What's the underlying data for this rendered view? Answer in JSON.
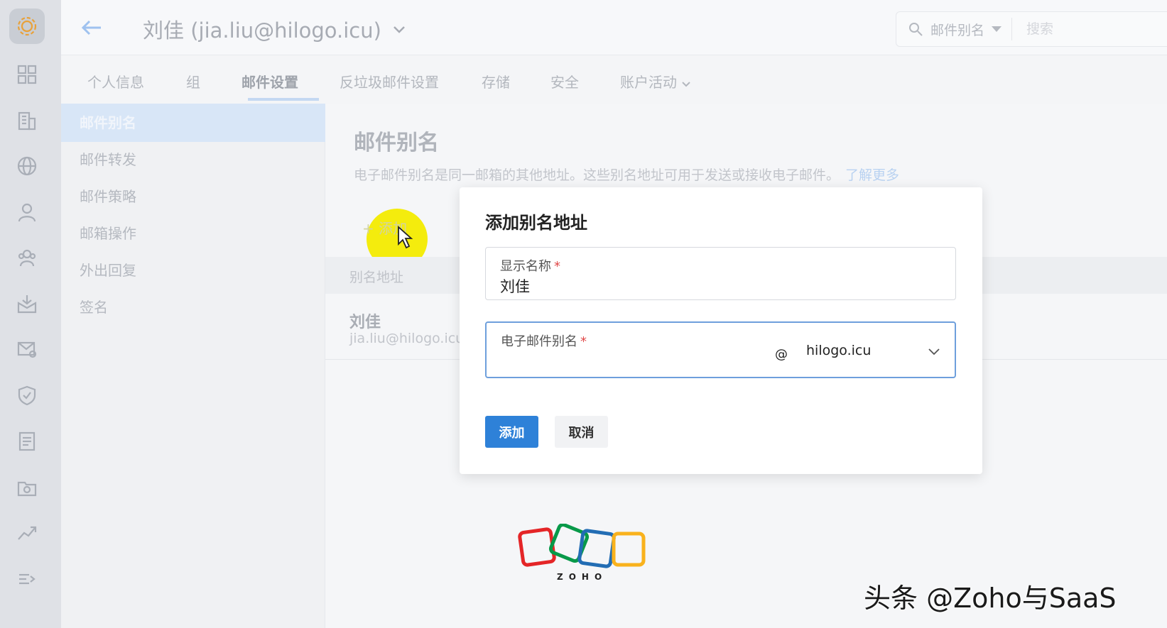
{
  "header": {
    "account": "刘佳 (jia.liu@hilogo.icu)",
    "search_scope": "邮件别名",
    "search_placeholder": "搜索"
  },
  "tabs": [
    {
      "label": "个人信息"
    },
    {
      "label": "组"
    },
    {
      "label": "邮件设置",
      "active": true
    },
    {
      "label": "反垃圾邮件设置"
    },
    {
      "label": "存储"
    },
    {
      "label": "安全"
    },
    {
      "label": "账户活动"
    }
  ],
  "submenu": [
    {
      "label": "邮件别名",
      "active": true
    },
    {
      "label": "邮件转发"
    },
    {
      "label": "邮件策略"
    },
    {
      "label": "邮箱操作"
    },
    {
      "label": "外出回复"
    },
    {
      "label": "签名"
    }
  ],
  "main": {
    "title": "邮件别名",
    "description": "电子邮件别名是同一邮箱的其他地址。这些别名地址可用于发送或接收电子邮件。",
    "learn_more": "了解更多",
    "add_button": "+ 添加",
    "table_header": "别名地址",
    "row": {
      "name": "刘佳",
      "address": "jia.liu@hilogo.icu"
    }
  },
  "dialog": {
    "title": "添加别名地址",
    "display_name_label": "显示名称",
    "display_name_value": "刘佳",
    "alias_label": "电子邮件别名",
    "alias_value": "",
    "at_sign": "@",
    "domain": "hilogo.icu",
    "required_mark": "*",
    "add_label": "添加",
    "cancel_label": "取消"
  },
  "branding": {
    "zoho_text": "ZOHO",
    "watermark": "头条 @Zoho与SaaS"
  },
  "colors": {
    "accent": "#2e81d8",
    "highlight": "#f4ec0d",
    "required": "#e04848"
  }
}
